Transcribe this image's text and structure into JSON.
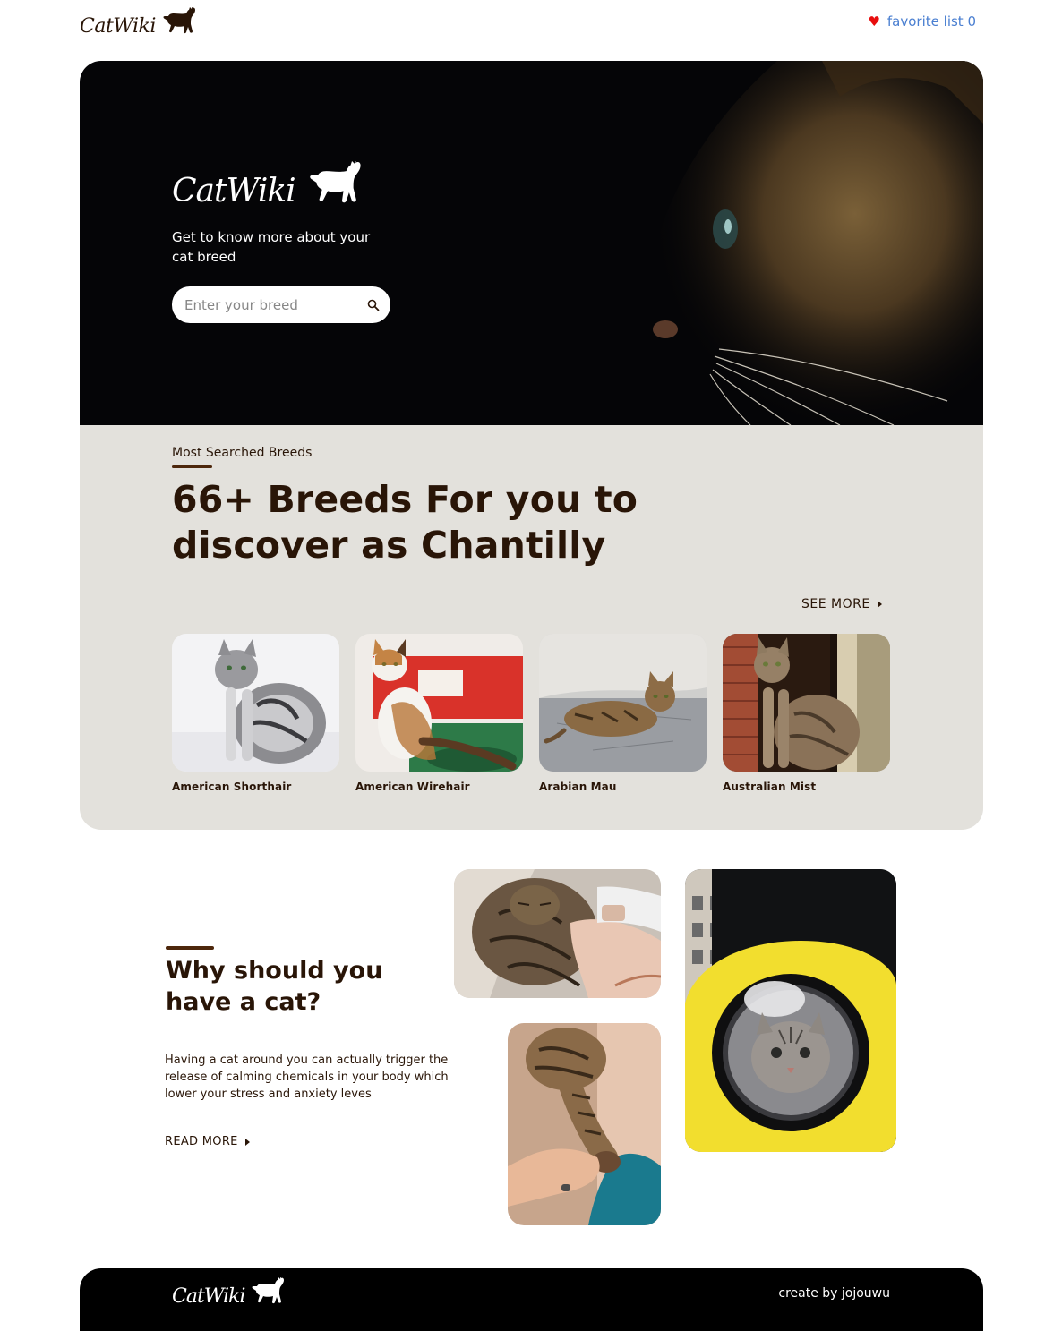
{
  "header": {
    "logo_text": "CatWiki",
    "favorite_label": "favorite list 0"
  },
  "hero": {
    "logo_text": "CatWiki",
    "tagline": "Get to know more about your cat breed",
    "search": {
      "placeholder": "Enter your breed",
      "value": ""
    }
  },
  "breeds_section": {
    "kicker": "Most Searched Breeds",
    "title": "66+ Breeds For you to discover as Chantilly",
    "see_more_label": "SEE MORE",
    "breeds": [
      {
        "name": "American Shorthair"
      },
      {
        "name": "American Wirehair"
      },
      {
        "name": "Arabian Mau"
      },
      {
        "name": "Australian Mist"
      }
    ]
  },
  "why_section": {
    "title": "Why should you have a cat?",
    "body": "Having a cat around you can actually trigger the release of calming chemicals in your body which lower your stress and anxiety leves",
    "read_more_label": "READ MORE"
  },
  "footer": {
    "logo_text": "CatWiki",
    "credit": "create by jojouwu"
  },
  "colors": {
    "brand_dark": "#291507",
    "hero_bg": "#050507",
    "section_bg": "#e3e1dc",
    "accent_bar": "#4d270c",
    "link_blue": "#4a7fd1",
    "heart_red": "#e80d0d"
  }
}
